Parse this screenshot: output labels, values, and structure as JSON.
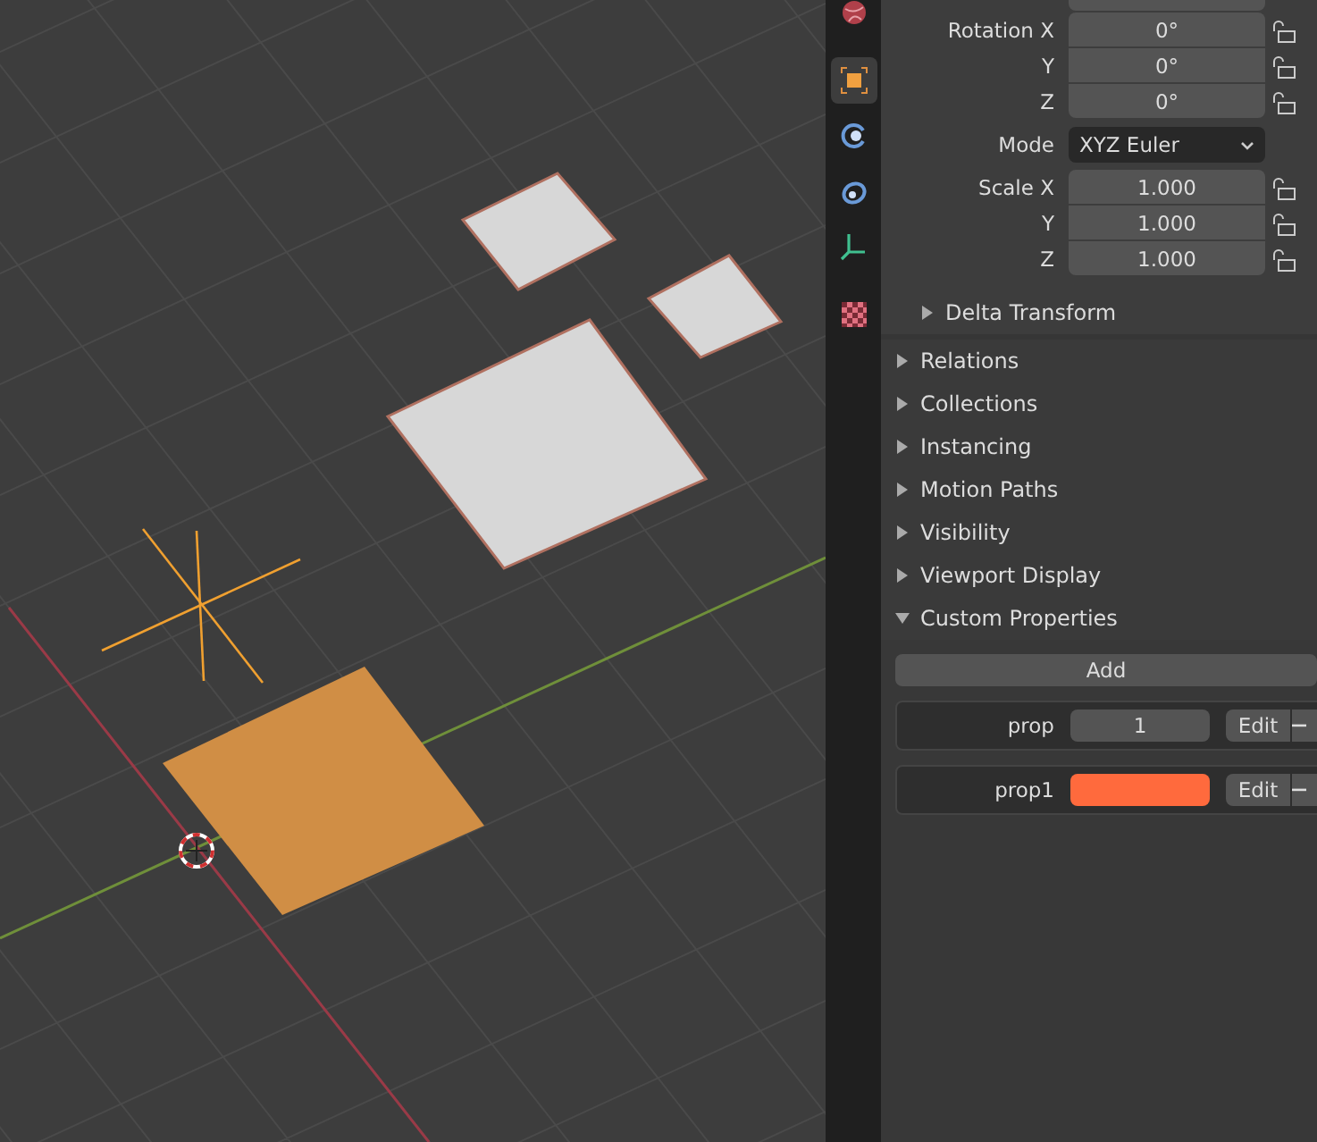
{
  "tabs": [
    {
      "kind": "world",
      "selected": false
    },
    {
      "kind": "object",
      "selected": true
    },
    {
      "kind": "physics",
      "selected": false
    },
    {
      "kind": "constraints",
      "selected": false
    },
    {
      "kind": "data",
      "selected": false
    },
    {
      "kind": "material",
      "selected": false
    }
  ],
  "transform": [
    {
      "kind": "number",
      "label": "Rotation X",
      "value": "0°",
      "locked": false
    },
    {
      "kind": "number",
      "label": "Y",
      "value": "0°",
      "locked": false
    },
    {
      "kind": "number",
      "label": "Z",
      "value": "0°",
      "locked": false
    },
    {
      "kind": "dropdown",
      "label": "Mode",
      "value": "XYZ Euler"
    },
    {
      "kind": "number",
      "label": "Scale X",
      "value": "1.000",
      "locked": false
    },
    {
      "kind": "number",
      "label": "Y",
      "value": "1.000",
      "locked": false
    },
    {
      "kind": "number",
      "label": "Z",
      "value": "1.000",
      "locked": false
    }
  ],
  "sections": [
    {
      "kind": "subpanel",
      "label": "Delta Transform",
      "expanded": false
    },
    {
      "kind": "panel",
      "label": "Relations",
      "expanded": false
    },
    {
      "kind": "panel",
      "label": "Collections",
      "expanded": false
    },
    {
      "kind": "panel",
      "label": "Instancing",
      "expanded": false
    },
    {
      "kind": "panel",
      "label": "Motion Paths",
      "expanded": false
    },
    {
      "kind": "panel",
      "label": "Visibility",
      "expanded": false
    },
    {
      "kind": "panel",
      "label": "Viewport Display",
      "expanded": false
    },
    {
      "kind": "panel",
      "label": "Custom Properties",
      "expanded": true
    }
  ],
  "custom_properties": {
    "add_button": "Add",
    "items": [
      {
        "kind": "number",
        "name": "prop",
        "value": "1",
        "edit_button": "Edit"
      },
      {
        "kind": "color",
        "name": "prop1",
        "color": "#ff6a3d",
        "edit_button": "Edit"
      }
    ]
  }
}
